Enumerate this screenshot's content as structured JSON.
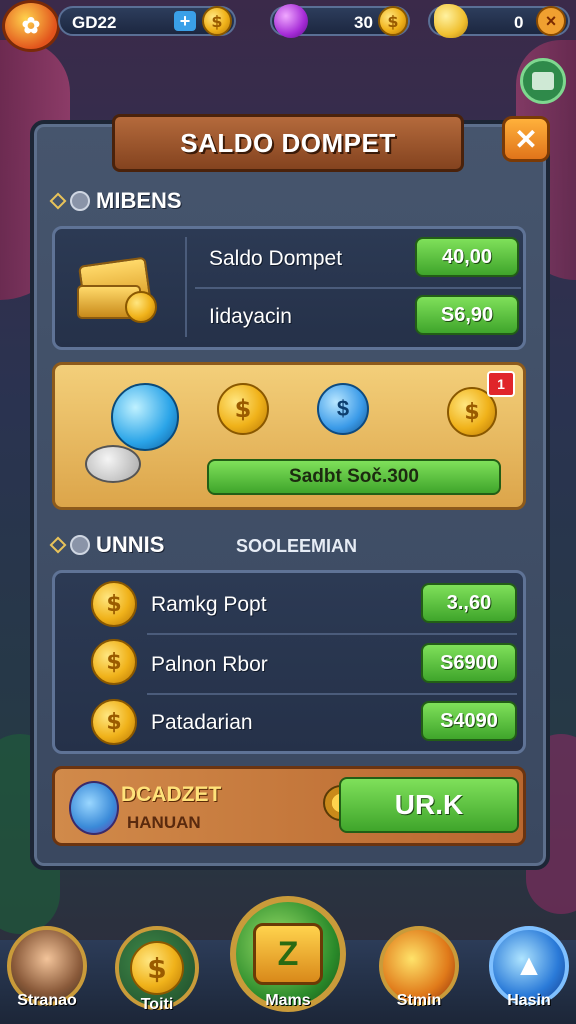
{
  "top_bar": {
    "gold": "GD22",
    "gems": "30",
    "tickets": "0"
  },
  "panel": {
    "title": "SALDO DOMPET",
    "section1": {
      "label": "MIBENS",
      "rows": [
        {
          "label": "Saldo Dompet",
          "value": "40,00"
        },
        {
          "label": "Iidayacin",
          "value": "S6,90"
        }
      ]
    },
    "promo": {
      "bar_text": "Sadbt Soč.300",
      "badge": "1"
    },
    "section2": {
      "label": "UNNIS",
      "sub_label": "SOOLEEMIAN",
      "rows": [
        {
          "label": "Ramkg Popt",
          "value": "3.,60"
        },
        {
          "label": "Palnon Rbor",
          "value": "S6900"
        },
        {
          "label": "Patadarian",
          "value": "S4090"
        }
      ]
    },
    "action": {
      "title": "DCADZET",
      "subtitle": "HANUAN",
      "button": "UR.K"
    }
  },
  "bottom_nav": [
    {
      "label": "Stranao"
    },
    {
      "label": "Toiti"
    },
    {
      "label": "Mams"
    },
    {
      "label": "Stmin"
    },
    {
      "label": "Hasin"
    }
  ],
  "colors": {
    "accent_green": "#4fbf35",
    "accent_orange": "#e88a25",
    "panel_bg": "#3f4d66"
  }
}
